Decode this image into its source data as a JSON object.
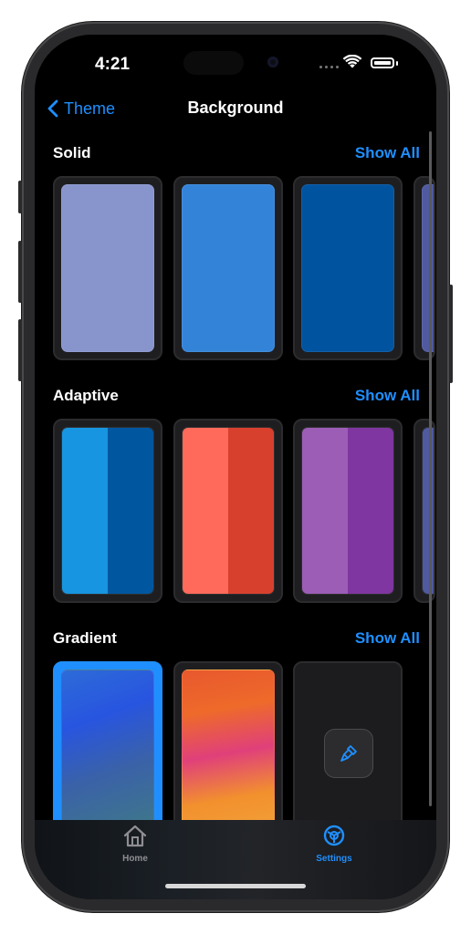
{
  "status": {
    "time": "4:21"
  },
  "nav": {
    "back_label": "Theme",
    "title": "Background"
  },
  "sections": [
    {
      "title": "Solid",
      "show_all": "Show All"
    },
    {
      "title": "Adaptive",
      "show_all": "Show All"
    },
    {
      "title": "Gradient",
      "show_all": "Show All"
    }
  ],
  "solid_colors": [
    "#8894cc",
    "#3384d9",
    "#00539f",
    "#4f5aa0"
  ],
  "adaptive_colors": [
    [
      "#1795e0",
      "#0057a0"
    ],
    [
      "#ff6a5a",
      "#d8402e"
    ],
    [
      "#9b5db5",
      "#7f36a0"
    ],
    [
      "#4f5aa0",
      "#4f5aa0"
    ]
  ],
  "gradient_selected_index": 0,
  "tabs": [
    {
      "label": "Home",
      "active": false
    },
    {
      "label": "Settings",
      "active": true
    }
  ],
  "colors": {
    "accent": "#1f8fff",
    "inactive": "#8e8e93"
  }
}
